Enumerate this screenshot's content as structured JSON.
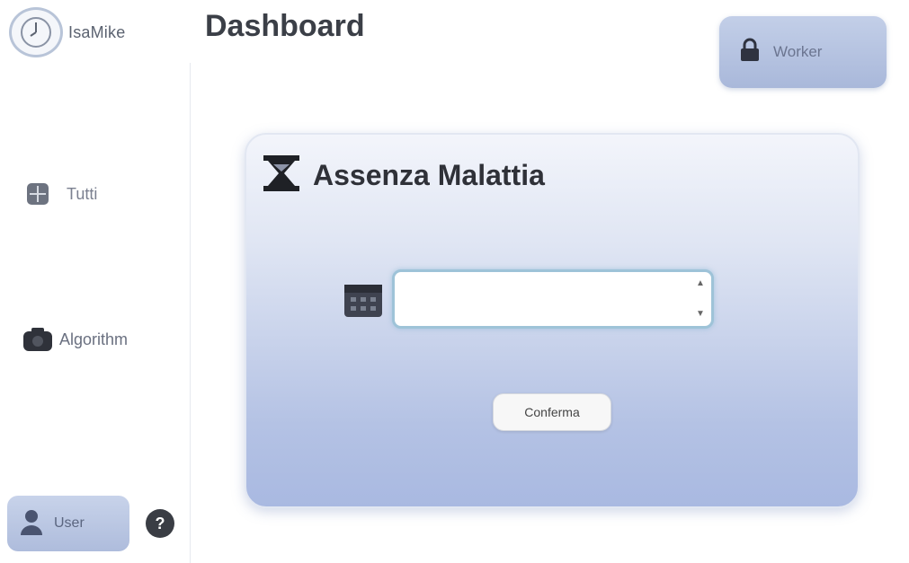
{
  "app": {
    "brand_name": "IsaMike",
    "page_title": "Dashboard"
  },
  "header": {
    "action_label": "Worker"
  },
  "sidebar": {
    "items": [
      {
        "label": "Tutti",
        "icon": "grid-icon"
      },
      {
        "label": "Algorithm",
        "icon": "camera-icon"
      }
    ],
    "user_label": "User",
    "help_label": "?"
  },
  "card": {
    "title": "Assenza Malattia",
    "date_input": {
      "value": "",
      "placeholder": ""
    },
    "confirm_label": "Conferma"
  },
  "colors": {
    "accent": "#aebcdc",
    "card_gradient_top": "#f3f5fb",
    "card_gradient_bottom": "#a9b9e1",
    "input_border": "#9ec3d8"
  }
}
